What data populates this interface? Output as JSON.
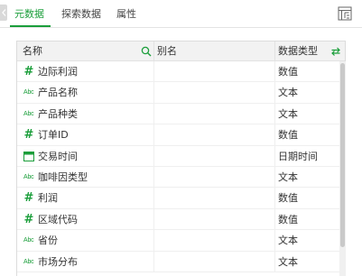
{
  "tabs": [
    {
      "label": "元数据",
      "active": true
    },
    {
      "label": "探索数据",
      "active": false
    },
    {
      "label": "属性",
      "active": false
    }
  ],
  "table": {
    "headers": {
      "name": "名称",
      "alias": "别名",
      "data_type": "数据类型"
    },
    "rows": [
      {
        "icon": "number-icon",
        "name": "边际利润",
        "alias": "",
        "data_type": "数值"
      },
      {
        "icon": "text-icon",
        "name": "产品名称",
        "alias": "",
        "data_type": "文本"
      },
      {
        "icon": "text-icon",
        "name": "产品种类",
        "alias": "",
        "data_type": "文本"
      },
      {
        "icon": "number-icon",
        "name": "订单ID",
        "alias": "",
        "data_type": "数值"
      },
      {
        "icon": "date-icon",
        "name": "交易时间",
        "alias": "",
        "data_type": "日期时间"
      },
      {
        "icon": "text-icon",
        "name": "咖啡因类型",
        "alias": "",
        "data_type": "文本"
      },
      {
        "icon": "number-icon",
        "name": "利润",
        "alias": "",
        "data_type": "数值"
      },
      {
        "icon": "number-icon",
        "name": "区域代码",
        "alias": "",
        "data_type": "数值"
      },
      {
        "icon": "text-icon",
        "name": "省份",
        "alias": "",
        "data_type": "文本"
      },
      {
        "icon": "text-icon",
        "name": "市场分布",
        "alias": "",
        "data_type": "文本"
      }
    ]
  },
  "icons": {
    "number_glyph": "#",
    "text_glyph": "Abc"
  },
  "colors": {
    "accent": "#1a9e3a",
    "header_bg": "#f2f2f2",
    "border": "#dcdcdc"
  }
}
